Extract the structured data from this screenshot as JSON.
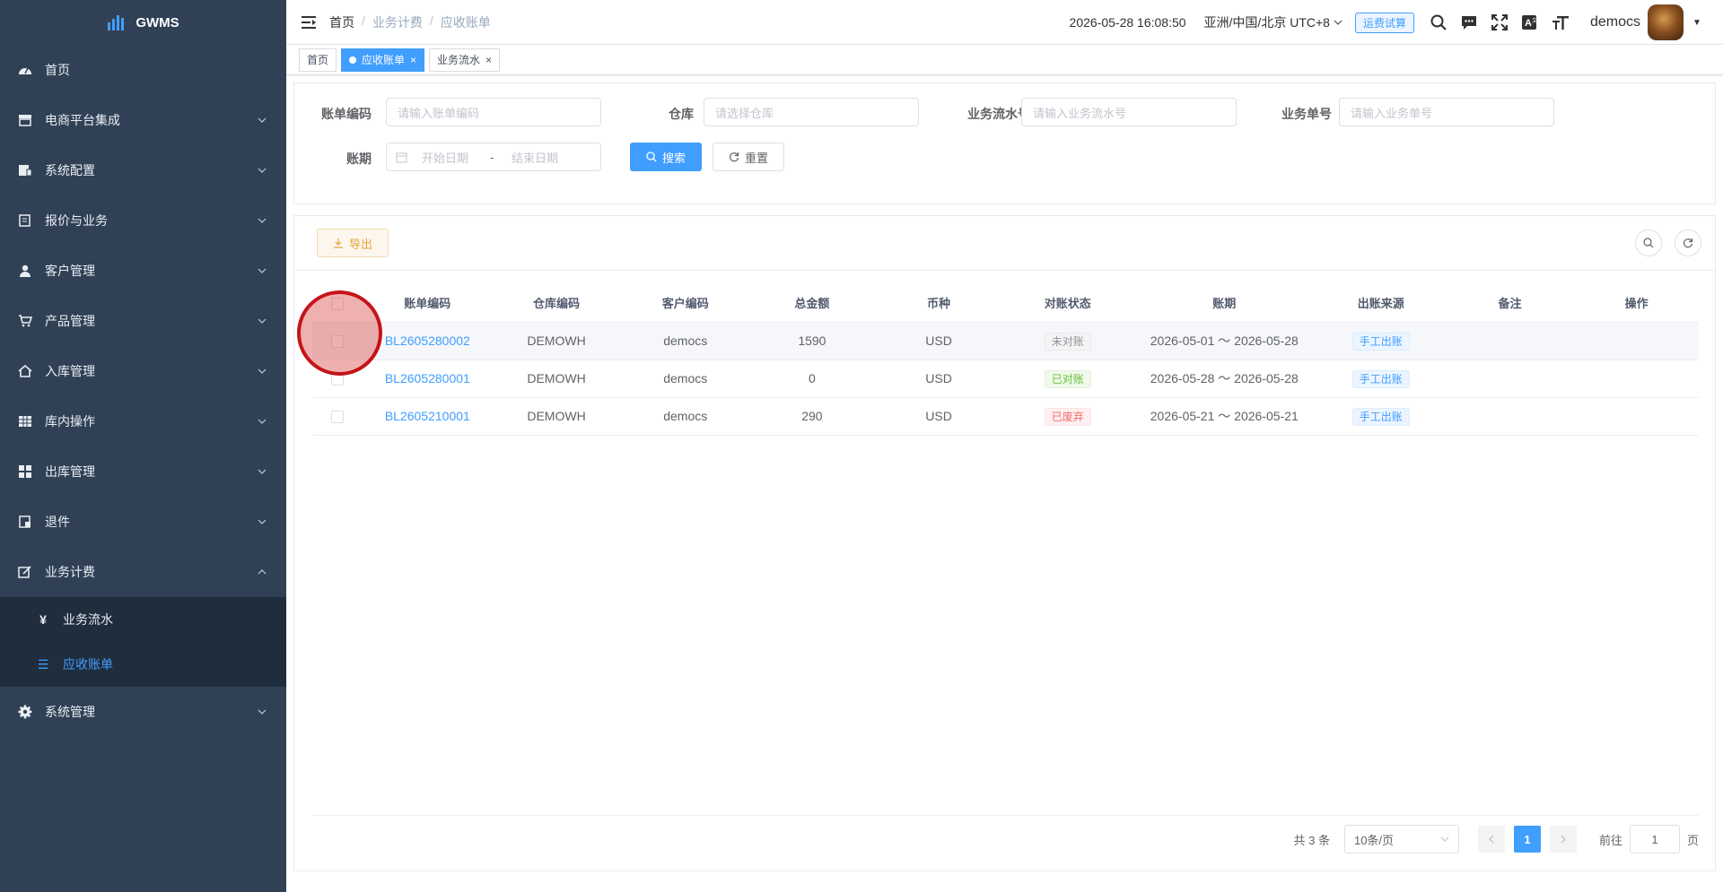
{
  "app": {
    "logo_text": "GWMS"
  },
  "sidebar": {
    "items": [
      {
        "label": "首页",
        "icon": "dashboard-icon",
        "expandable": false
      },
      {
        "label": "电商平台集成",
        "icon": "store-icon",
        "expandable": true
      },
      {
        "label": "系统配置",
        "icon": "config-icon",
        "expandable": true
      },
      {
        "label": "报价与业务",
        "icon": "quote-icon",
        "expandable": true
      },
      {
        "label": "客户管理",
        "icon": "user-icon",
        "expandable": true
      },
      {
        "label": "产品管理",
        "icon": "cart-icon",
        "expandable": true
      },
      {
        "label": "入库管理",
        "icon": "home-icon",
        "expandable": true
      },
      {
        "label": "库内操作",
        "icon": "grid-icon",
        "expandable": true
      },
      {
        "label": "出库管理",
        "icon": "apps-icon",
        "expandable": true
      },
      {
        "label": "退件",
        "icon": "return-icon",
        "expandable": true
      },
      {
        "label": "业务计费",
        "icon": "edit-icon",
        "expandable": true,
        "open": true
      },
      {
        "label": "系统管理",
        "icon": "gear-icon",
        "expandable": true
      }
    ],
    "sub_items": [
      {
        "label": "业务流水",
        "icon": "yen-icon"
      },
      {
        "label": "应收账单",
        "icon": "list-icon",
        "active": true
      }
    ]
  },
  "navbar": {
    "breadcrumb": [
      "首页",
      "业务计费",
      "应收账单"
    ],
    "datetime": "2026-05-28 16:08:50",
    "timezone": "亚洲/中国/北京 UTC+8",
    "calc_button": "运费试算",
    "username": "democs"
  },
  "tags": [
    {
      "label": "首页",
      "active": false,
      "closable": false
    },
    {
      "label": "应收账单",
      "active": true,
      "closable": true
    },
    {
      "label": "业务流水",
      "active": false,
      "closable": true
    }
  ],
  "search": {
    "bill_code_label": "账单编码",
    "bill_code_placeholder": "请输入账单编码",
    "warehouse_label": "仓库",
    "warehouse_placeholder": "请选择仓库",
    "flow_no_label": "业务流水号",
    "flow_no_placeholder": "请输入业务流水号",
    "biz_no_label": "业务单号",
    "biz_no_placeholder": "请输入业务单号",
    "period_label": "账期",
    "start_placeholder": "开始日期",
    "range_sep": "-",
    "end_placeholder": "结束日期",
    "search_button": "搜索",
    "reset_button": "重置"
  },
  "toolbar": {
    "export_label": "导出"
  },
  "table": {
    "columns": [
      "账单编码",
      "仓库编码",
      "客户编码",
      "总金额",
      "币种",
      "对账状态",
      "账期",
      "出账来源",
      "备注",
      "操作"
    ],
    "rows": [
      {
        "code": "BL2605280002",
        "warehouse": "DEMOWH",
        "customer": "democs",
        "amount": "1590",
        "currency": "USD",
        "status": "未对账",
        "status_type": "gray",
        "period": "2026-05-01 ～ 2026-05-28",
        "source": "手工出账",
        "remark": "",
        "ops": ""
      },
      {
        "code": "BL2605280001",
        "warehouse": "DEMOWH",
        "customer": "democs",
        "amount": "0",
        "currency": "USD",
        "status": "已对账",
        "status_type": "green",
        "period": "2026-05-28 ～ 2026-05-28",
        "source": "手工出账",
        "remark": "",
        "ops": ""
      },
      {
        "code": "BL2605210001",
        "warehouse": "DEMOWH",
        "customer": "democs",
        "amount": "290",
        "currency": "USD",
        "status": "已废弃",
        "status_type": "red",
        "period": "2026-05-21 ～ 2026-05-21",
        "source": "手工出账",
        "remark": "",
        "ops": ""
      }
    ]
  },
  "pagination": {
    "total": "共 3 条",
    "page_size": "10条/页",
    "current": "1",
    "goto_label": "前往",
    "goto_value": "1",
    "page_suffix": "页"
  },
  "colors": {
    "primary": "#409eff",
    "sidebar_bg": "#304156",
    "submenu_bg": "#1f2d3d"
  }
}
